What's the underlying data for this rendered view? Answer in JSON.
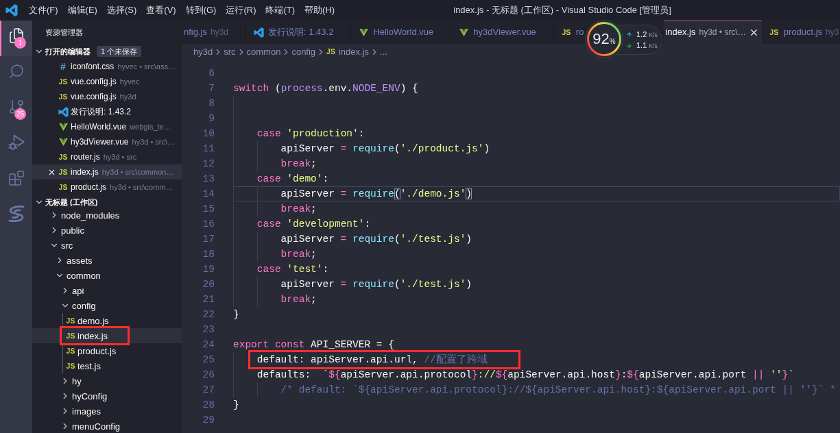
{
  "title_bar": {
    "menus": [
      "文件(F)",
      "编辑(E)",
      "选择(S)",
      "查看(V)",
      "转到(G)",
      "运行(R)",
      "终端(T)",
      "帮助(H)"
    ],
    "title": "index.js - 无标题 (工作区) - Visual Studio Code [管理员]"
  },
  "activity_bar": {
    "items": [
      {
        "kind": "explorer",
        "selected": true,
        "badge": "1"
      },
      {
        "kind": "search",
        "selected": false
      },
      {
        "kind": "source-control",
        "selected": false,
        "badge": "25"
      },
      {
        "kind": "run-debug",
        "selected": false
      },
      {
        "kind": "extensions",
        "selected": false
      },
      {
        "kind": "s-logo",
        "selected": false
      }
    ]
  },
  "sidebar": {
    "title": "资源管理器",
    "open_editors": {
      "title": "打开的编辑器",
      "expanded": true,
      "badge": "1 个未保存",
      "items": [
        {
          "name": "iconfont.css",
          "description": "hyvec • src\\ass…",
          "kind": "css",
          "icon_label": "#",
          "selected": false
        },
        {
          "name": "vue.config.js",
          "description": "hyvec",
          "kind": "js",
          "icon_label": "JS",
          "selected": false
        },
        {
          "name": "vue.config.js",
          "description": "hy3d",
          "kind": "js",
          "icon_label": "JS",
          "selected": false
        },
        {
          "name": "发行说明: 1.43.2",
          "kind": "vscode",
          "selected": false
        },
        {
          "name": "HelloWorld.vue",
          "description": "webgis_te…",
          "kind": "vue",
          "selected": false
        },
        {
          "name": "hy3dViewer.vue",
          "description": "hy3d • src\\…",
          "kind": "vue",
          "selected": false
        },
        {
          "name": "router.js",
          "description": "hy3d • src",
          "kind": "js",
          "icon_label": "JS",
          "selected": false
        },
        {
          "name": "index.js",
          "description": "hy3d • src\\common…",
          "kind": "js",
          "icon_label": "JS",
          "selected": true
        },
        {
          "name": "product.js",
          "description": "hy3d • src\\comm…",
          "kind": "js",
          "icon_label": "JS",
          "selected": false
        }
      ]
    },
    "workspace": {
      "title": "无标题 (工作区)",
      "expanded": true,
      "tree": [
        {
          "label": "node_modules",
          "kind": "folder",
          "expanded": false,
          "selected": false,
          "highlighted": false
        },
        {
          "label": "public",
          "kind": "folder",
          "expanded": false,
          "selected": false,
          "highlighted": false
        },
        {
          "label": "src",
          "kind": "folder",
          "expanded": true,
          "selected": false,
          "highlighted": false,
          "children": [
            {
              "label": "assets",
              "kind": "folder",
              "expanded": false,
              "selected": false,
              "highlighted": false
            },
            {
              "label": "common",
              "kind": "folder",
              "expanded": true,
              "selected": false,
              "highlighted": false,
              "children": [
                {
                  "label": "api",
                  "kind": "folder",
                  "expanded": false,
                  "selected": false,
                  "highlighted": false
                },
                {
                  "label": "config",
                  "kind": "folder",
                  "expanded": true,
                  "selected": false,
                  "highlighted": false,
                  "children": [
                    {
                      "label": "demo.js",
                      "kind": "js",
                      "icon_label": "JS",
                      "selected": false,
                      "highlighted": false
                    },
                    {
                      "label": "index.js",
                      "kind": "js",
                      "icon_label": "JS",
                      "selected": true,
                      "highlighted": true
                    },
                    {
                      "label": "product.js",
                      "kind": "js",
                      "icon_label": "JS",
                      "selected": false,
                      "highlighted": false
                    },
                    {
                      "label": "test.js",
                      "kind": "js",
                      "icon_label": "JS",
                      "selected": false,
                      "highlighted": false
                    }
                  ]
                },
                {
                  "label": "hy",
                  "kind": "folder",
                  "expanded": false,
                  "selected": false,
                  "highlighted": false
                },
                {
                  "label": "hyConfig",
                  "kind": "folder",
                  "expanded": false,
                  "selected": false,
                  "highlighted": false
                },
                {
                  "label": "images",
                  "kind": "folder",
                  "expanded": false,
                  "selected": false,
                  "highlighted": false
                },
                {
                  "label": "menuConfig",
                  "kind": "folder",
                  "expanded": false,
                  "selected": false,
                  "highlighted": false
                }
              ]
            }
          ]
        }
      ]
    }
  },
  "tabs": [
    {
      "label": "nfig.js",
      "description": "hy3d",
      "selected": false
    },
    {
      "label": "发行说明: 1.43.2",
      "kind": "vscode",
      "selected": false
    },
    {
      "label": "HelloWorld.vue",
      "kind": "vue",
      "selected": false
    },
    {
      "label": "hy3dViewer.vue",
      "kind": "vue",
      "selected": false
    },
    {
      "label": "ro",
      "kind": "js",
      "icon_label": "JS",
      "selected": false
    },
    {
      "label": "index.js",
      "description": "hy3d • src\\…",
      "selected": true
    },
    {
      "label": "product.js",
      "description": "hy3",
      "kind": "js",
      "icon_label": "JS",
      "selected": false
    }
  ],
  "net_monitor": {
    "percent": "92",
    "percent_sign": "%",
    "rates": [
      {
        "kind": "up",
        "value": "1.2",
        "unit": "K/s"
      },
      {
        "kind": "down",
        "value": "1.1",
        "unit": "K/s"
      }
    ]
  },
  "breadcrumb": [
    {
      "label": "hy3d"
    },
    {
      "label": "src"
    },
    {
      "label": "common"
    },
    {
      "label": "config"
    },
    {
      "label": "index.js",
      "kind": "js",
      "icon_label": "JS"
    },
    {
      "label": "..."
    }
  ],
  "editor": {
    "lines": [
      {
        "number": "6",
        "current": false,
        "highlighted": false
      },
      {
        "number": "7",
        "tokens": [
          {
            "kind": "keyword",
            "text": "switch"
          },
          {
            "kind": "plain",
            "text": " ("
          },
          {
            "kind": "variable",
            "text": "process"
          },
          {
            "kind": "plain",
            "text": ".env."
          },
          {
            "kind": "variable",
            "text": "NODE_ENV"
          },
          {
            "kind": "plain",
            "text": ") {"
          }
        ],
        "current": false,
        "highlighted": false,
        "children": [
          {
            "number": "8",
            "current": false,
            "highlighted": false
          },
          {
            "number": "9",
            "current": false,
            "highlighted": false
          },
          {
            "number": "10",
            "tokens": [
              {
                "kind": "keyword",
                "text": "case "
              },
              {
                "kind": "string",
                "text": "'production'"
              },
              {
                "kind": "plain",
                "text": ":"
              }
            ],
            "current": false,
            "highlighted": false,
            "children": [
              {
                "number": "11",
                "tokens": [
                  {
                    "kind": "plain",
                    "text": "apiServer "
                  },
                  {
                    "kind": "keyword",
                    "text": "= "
                  },
                  {
                    "kind": "function",
                    "text": "require"
                  },
                  {
                    "kind": "plain",
                    "text": "("
                  },
                  {
                    "kind": "string",
                    "text": "'./product.js'"
                  },
                  {
                    "kind": "plain",
                    "text": ")"
                  }
                ],
                "current": false,
                "highlighted": false
              },
              {
                "number": "12",
                "tokens": [
                  {
                    "kind": "keyword",
                    "text": "break"
                  },
                  {
                    "kind": "plain",
                    "text": ";"
                  }
                ],
                "current": false,
                "highlighted": false
              }
            ]
          },
          {
            "number": "13",
            "tokens": [
              {
                "kind": "keyword",
                "text": "case "
              },
              {
                "kind": "string",
                "text": "'demo'"
              },
              {
                "kind": "plain",
                "text": ":"
              }
            ],
            "current": false,
            "highlighted": false,
            "children": [
              {
                "number": "14",
                "tokens": [
                  {
                    "kind": "plain",
                    "text": "apiServer "
                  },
                  {
                    "kind": "keyword",
                    "text": "= "
                  },
                  {
                    "kind": "function",
                    "text": "require"
                  },
                  {
                    "kind": "bracket",
                    "text": "("
                  },
                  {
                    "kind": "string",
                    "text": "'./demo.js'"
                  },
                  {
                    "kind": "bracket",
                    "text": ")"
                  }
                ],
                "current": true,
                "highlighted": false
              },
              {
                "number": "15",
                "tokens": [
                  {
                    "kind": "keyword",
                    "text": "break"
                  },
                  {
                    "kind": "plain",
                    "text": ";"
                  }
                ],
                "current": false,
                "highlighted": false
              }
            ]
          },
          {
            "number": "16",
            "tokens": [
              {
                "kind": "keyword",
                "text": "case "
              },
              {
                "kind": "string",
                "text": "'development'"
              },
              {
                "kind": "plain",
                "text": ":"
              }
            ],
            "current": false,
            "highlighted": false,
            "children": [
              {
                "number": "17",
                "tokens": [
                  {
                    "kind": "plain",
                    "text": "apiServer "
                  },
                  {
                    "kind": "keyword",
                    "text": "= "
                  },
                  {
                    "kind": "function",
                    "text": "require"
                  },
                  {
                    "kind": "plain",
                    "text": "("
                  },
                  {
                    "kind": "string",
                    "text": "'./test.js'"
                  },
                  {
                    "kind": "plain",
                    "text": ")"
                  }
                ],
                "current": false,
                "highlighted": false
              },
              {
                "number": "18",
                "tokens": [
                  {
                    "kind": "keyword",
                    "text": "break"
                  },
                  {
                    "kind": "plain",
                    "text": ";"
                  }
                ],
                "current": false,
                "highlighted": false
              }
            ]
          },
          {
            "number": "19",
            "tokens": [
              {
                "kind": "keyword",
                "text": "case "
              },
              {
                "kind": "string",
                "text": "'test'"
              },
              {
                "kind": "plain",
                "text": ":"
              }
            ],
            "current": false,
            "highlighted": false,
            "children": [
              {
                "number": "20",
                "tokens": [
                  {
                    "kind": "plain",
                    "text": "apiServer "
                  },
                  {
                    "kind": "keyword",
                    "text": "= "
                  },
                  {
                    "kind": "function",
                    "text": "require"
                  },
                  {
                    "kind": "plain",
                    "text": "("
                  },
                  {
                    "kind": "string",
                    "text": "'./test.js'"
                  },
                  {
                    "kind": "plain",
                    "text": ")"
                  }
                ],
                "current": false,
                "highlighted": false
              },
              {
                "number": "21",
                "tokens": [
                  {
                    "kind": "keyword",
                    "text": "break"
                  },
                  {
                    "kind": "plain",
                    "text": ";"
                  }
                ],
                "current": false,
                "highlighted": false
              }
            ]
          }
        ]
      },
      {
        "number": "22",
        "tokens": [
          {
            "kind": "plain",
            "text": "}"
          }
        ],
        "current": false,
        "highlighted": false
      },
      {
        "number": "23",
        "current": false,
        "highlighted": false
      },
      {
        "number": "24",
        "tokens": [
          {
            "kind": "keyword",
            "text": "export const"
          },
          {
            "kind": "plain",
            "text": " API_SERVER = {"
          }
        ],
        "current": false,
        "highlighted": false,
        "children": [
          {
            "number": "25",
            "tokens": [
              {
                "kind": "plain",
                "text": "default: apiServer.api.url, "
              },
              {
                "kind": "comment",
                "text": "//配置了跨域"
              }
            ],
            "current": false,
            "highlighted": true
          },
          {
            "number": "26",
            "tokens": [
              {
                "kind": "plain",
                "text": "defaults:  "
              },
              {
                "kind": "string",
                "text": "`"
              },
              {
                "kind": "template",
                "text": "${"
              },
              {
                "kind": "plain",
                "text": "apiServer.api.protocol"
              },
              {
                "kind": "template",
                "text": "}"
              },
              {
                "kind": "string",
                "text": "://"
              },
              {
                "kind": "template",
                "text": "${"
              },
              {
                "kind": "plain",
                "text": "apiServer.api.host"
              },
              {
                "kind": "template",
                "text": "}"
              },
              {
                "kind": "string",
                "text": ":"
              },
              {
                "kind": "template",
                "text": "${"
              },
              {
                "kind": "plain",
                "text": "apiServer.api.port "
              },
              {
                "kind": "keyword",
                "text": "|| "
              },
              {
                "kind": "string",
                "text": "''"
              },
              {
                "kind": "template",
                "text": "}"
              },
              {
                "kind": "string",
                "text": "`"
              }
            ],
            "current": false,
            "highlighted": false,
            "children": [
              {
                "number": "27",
                "tokens": [
                  {
                    "kind": "comment",
                    "text": "/* default: `${apiServer.api.protocol}://${apiServer.api.host}:${apiServer.api.port || ''}` *"
                  }
                ],
                "current": false,
                "highlighted": false
              }
            ]
          }
        ]
      },
      {
        "number": "28",
        "tokens": [
          {
            "kind": "plain",
            "text": "}"
          }
        ],
        "current": false,
        "highlighted": false
      },
      {
        "number": "29",
        "current": false,
        "highlighted": false
      }
    ]
  }
}
